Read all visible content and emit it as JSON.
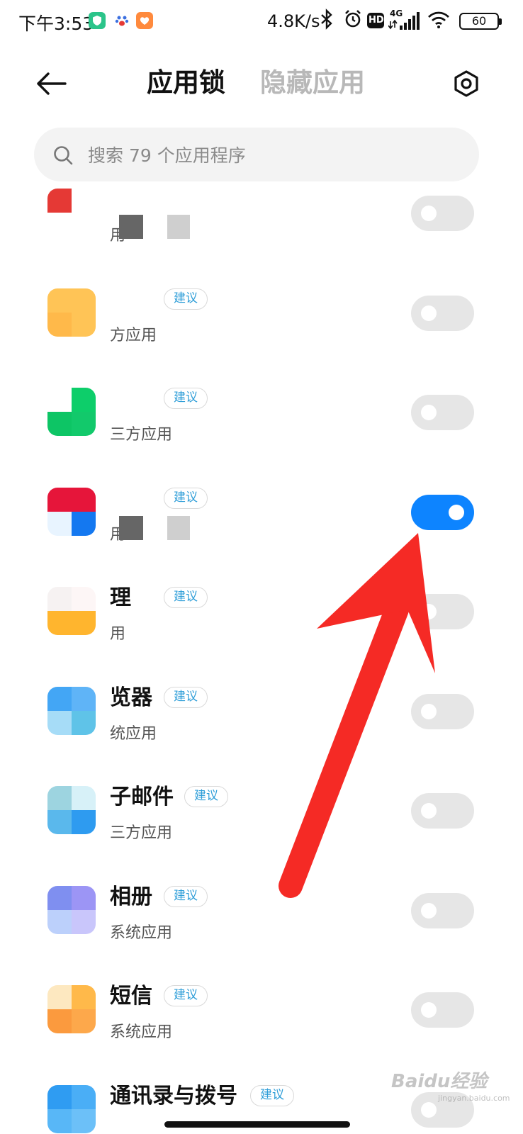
{
  "status_bar": {
    "time": "下午3:53",
    "net_speed": "4.8K/s",
    "network_type": "4G",
    "hd_label": "HD",
    "battery": "60",
    "icons": [
      "shield-app-icon",
      "paw-app-icon",
      "heart-app-icon",
      "bluetooth-icon",
      "alarm-icon",
      "hd-icon",
      "signal-icon",
      "wifi-icon",
      "battery-icon"
    ]
  },
  "header": {
    "tabs": [
      {
        "label": "应用锁",
        "active": true
      },
      {
        "label": "隐藏应用",
        "active": false
      }
    ]
  },
  "search": {
    "placeholder": "搜索 79 个应用程序"
  },
  "badge_label": "建议",
  "apps": [
    {
      "name": "",
      "category": "用",
      "badge": false,
      "locked": false,
      "icon_colors": [
        "#e53935",
        "#ffffff",
        "#ffffff",
        "#ffffff"
      ]
    },
    {
      "name": "",
      "category": "方应用",
      "badge": true,
      "locked": false,
      "icon_colors": [
        "#ffc456",
        "#ffc456",
        "#ffb94a",
        "#ffc456"
      ]
    },
    {
      "name": "",
      "category": "三方应用",
      "badge": true,
      "locked": false,
      "icon_colors": [
        "#ffffff",
        "#0dce6a",
        "#0dc565",
        "#12c96b"
      ]
    },
    {
      "name": "",
      "category": "用",
      "badge": true,
      "locked": true,
      "icon_colors": [
        "#e6153a",
        "#e6153a",
        "#e8f4ff",
        "#1478f0"
      ]
    },
    {
      "name": "理",
      "category": "用",
      "badge": true,
      "locked": false,
      "icon_colors": [
        "#f6f2f2",
        "#fdf6f6",
        "#ffb52e",
        "#ffb52e"
      ]
    },
    {
      "name": "览器",
      "category": "统应用",
      "badge": true,
      "locked": false,
      "icon_colors": [
        "#43a6f5",
        "#5fb4f7",
        "#a6dcf7",
        "#5fc3e8"
      ]
    },
    {
      "name": "子邮件",
      "category": "三方应用",
      "badge": true,
      "locked": false,
      "icon_colors": [
        "#9dd4e0",
        "#d7f1f8",
        "#5ab8ec",
        "#2e9bf0"
      ]
    },
    {
      "name": "相册",
      "category": "系统应用",
      "badge": true,
      "locked": false,
      "icon_colors": [
        "#7f8ff0",
        "#9c95f5",
        "#bcd0fb",
        "#c9c6fb"
      ]
    },
    {
      "name": "短信",
      "category": "系统应用",
      "badge": true,
      "locked": false,
      "icon_colors": [
        "#fde8c0",
        "#ffb94a",
        "#fb9a3e",
        "#fda84b"
      ]
    },
    {
      "name": "通讯录与拨号",
      "category": "",
      "badge": true,
      "locked": false,
      "icon_colors": [
        "#2f9cf2",
        "#4aaef6",
        "#58b7f7",
        "#6cc0f8"
      ]
    }
  ],
  "watermark": {
    "text": "Baidu经验",
    "sub": "jingyan.baidu.com"
  },
  "colors": {
    "accent": "#0d84ff",
    "badge_text": "#2f9ed8",
    "annotation_arrow": "#f52a25"
  }
}
